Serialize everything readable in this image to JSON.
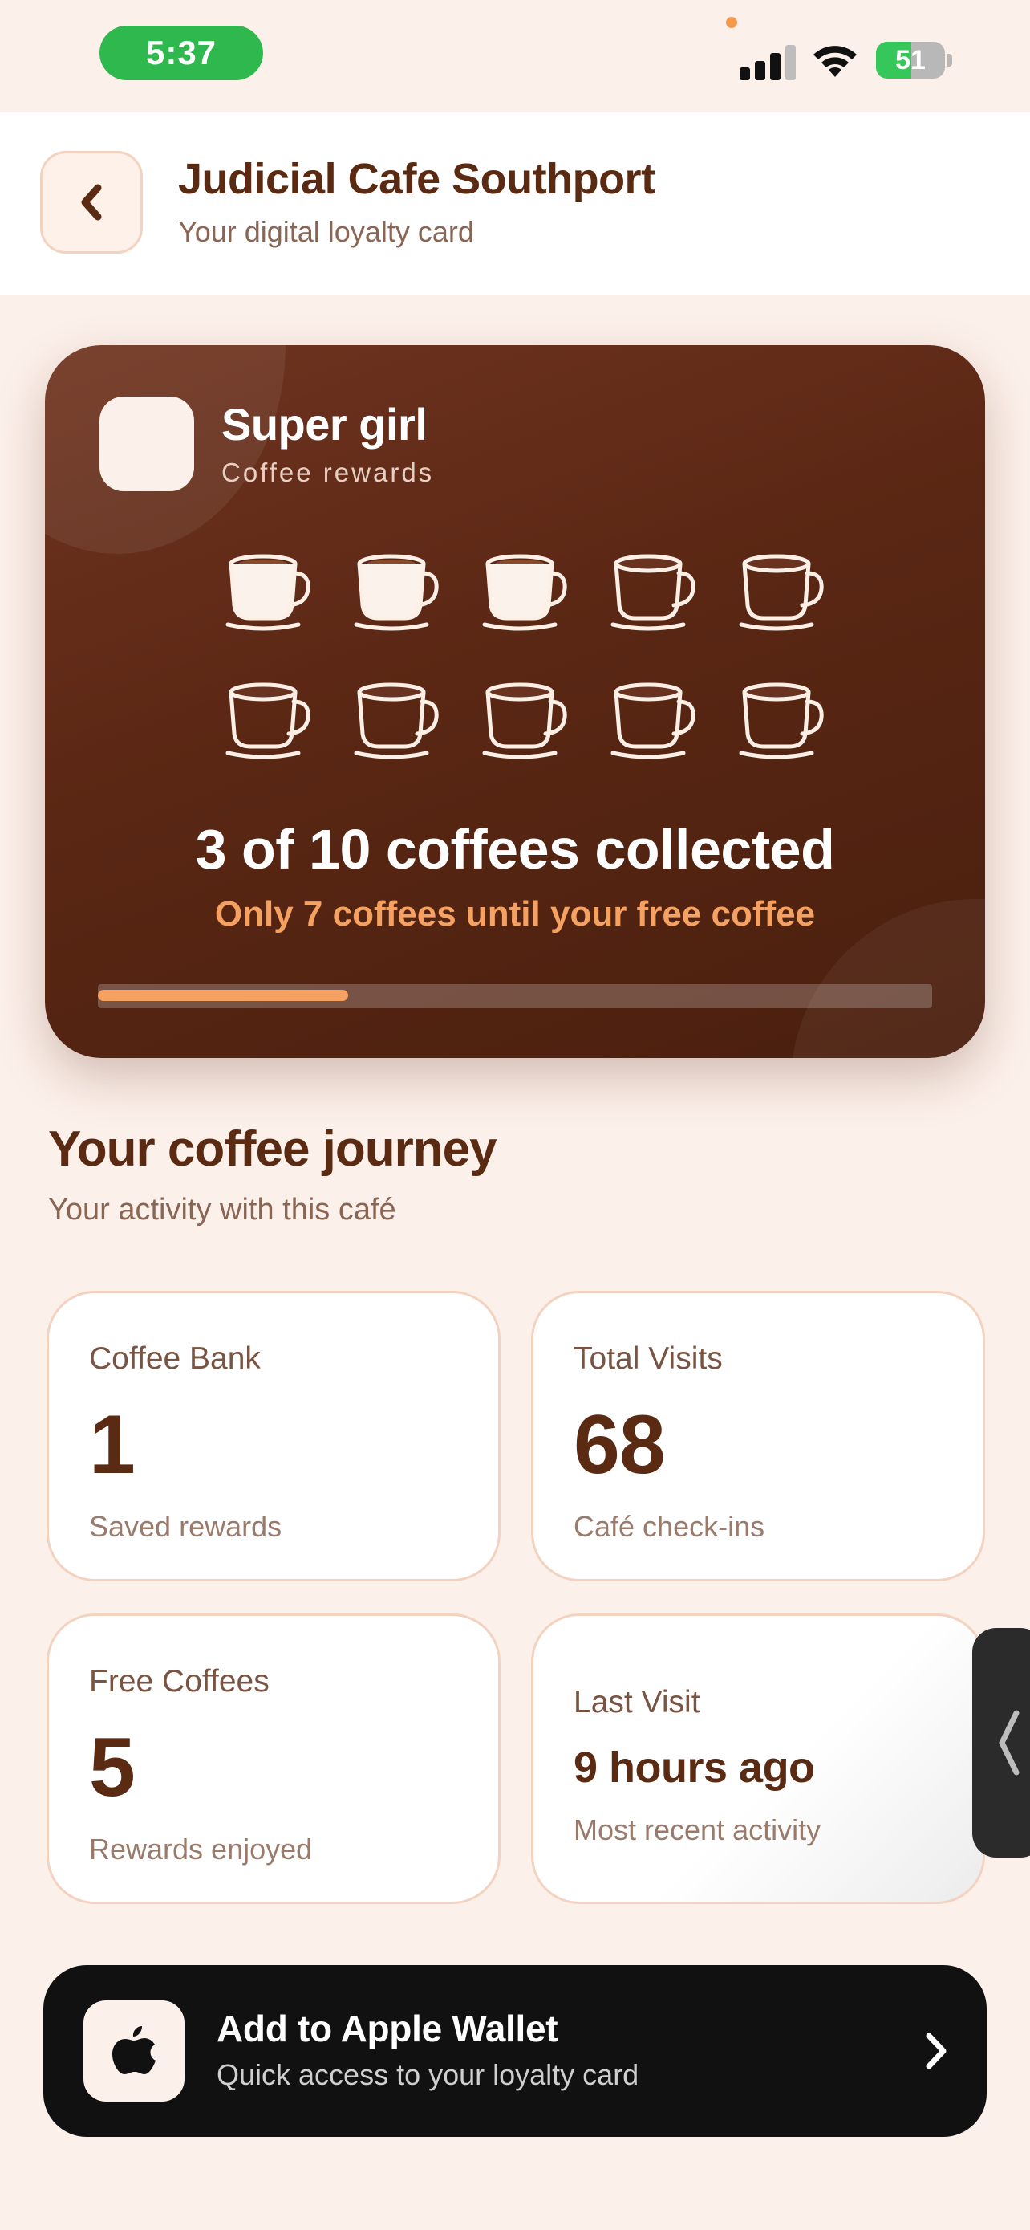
{
  "status_bar": {
    "time": "5:37",
    "battery_percent": 51,
    "signal_bars_active": 3,
    "signal_bars_total": 4,
    "icons": [
      "signal-icon",
      "wifi-icon",
      "battery-charging-icon"
    ]
  },
  "header": {
    "title": "Judicial Cafe Southport",
    "subtitle": "Your digital loyalty card",
    "back_icon": "chevron-left-icon"
  },
  "loyalty_card": {
    "name": "Super girl",
    "subtitle": "Coffee rewards",
    "stamps_collected": 3,
    "stamps_total": 10,
    "count_text": "3 of 10 coffees collected",
    "until_text": "Only 7 coffees until your free coffee",
    "progress_fraction": 0.3,
    "colors": {
      "card": "#5a2714",
      "accent": "#f5a161",
      "cup_outline": "#fcefe6"
    }
  },
  "journey": {
    "title": "Your coffee journey",
    "subtitle": "Your activity with this café"
  },
  "stats": {
    "coffee_bank": {
      "label": "Coffee Bank",
      "value": "1",
      "note": "Saved rewards"
    },
    "total_visits": {
      "label": "Total Visits",
      "value": "68",
      "note": "Café check-ins"
    },
    "free_coffees": {
      "label": "Free Coffees",
      "value": "5",
      "note": "Rewards enjoyed"
    },
    "last_visit": {
      "label": "Last Visit",
      "value": "9 hours ago",
      "note": "Most recent activity"
    }
  },
  "wallet": {
    "title": "Add to Apple Wallet",
    "subtitle": "Quick access to your loyalty card",
    "icon": "apple-logo-icon",
    "chevron_icon": "chevron-right-icon"
  },
  "side_handle": {
    "icon": "chevron-left-icon"
  },
  "colors": {
    "background": "#fcf0ea",
    "text_primary": "#5a2a12",
    "text_secondary": "#8a6554",
    "wallet_button": "#111111",
    "time_pill": "#2eb84e"
  }
}
